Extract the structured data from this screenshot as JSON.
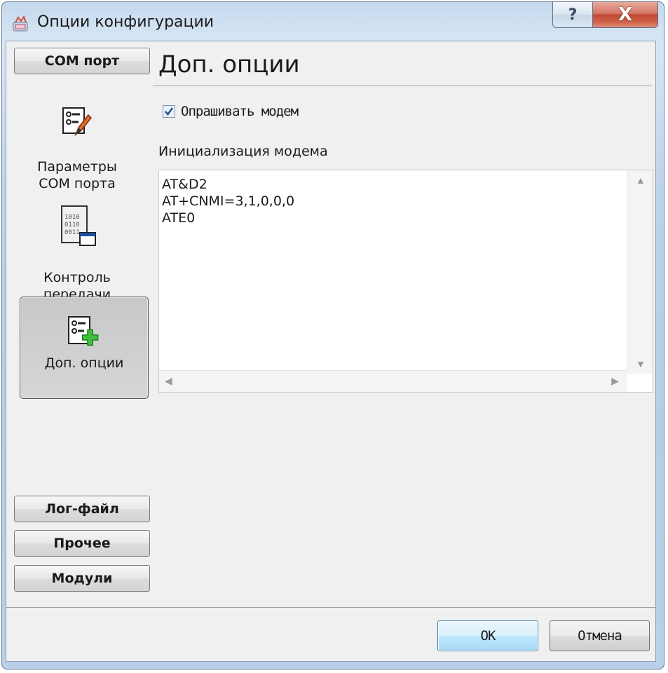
{
  "window": {
    "title": "Опции конфигурации",
    "help_label": "?",
    "close_label": "X"
  },
  "sidebar": {
    "top_button": "COM порт",
    "items": [
      {
        "label": "Параметры\nCOM порта",
        "icon": "settings-edit-icon"
      },
      {
        "label": "Контроль\nпередачи\nданных",
        "icon": "data-transfer-icon"
      },
      {
        "label": "Доп. опции",
        "icon": "settings-add-icon",
        "active": true
      }
    ],
    "bottom_buttons": [
      "Лог-файл",
      "Прочее",
      "Модули"
    ]
  },
  "main": {
    "heading": "Доп. опции",
    "poll_modem": {
      "label": "Опрашивать модем",
      "checked": true
    },
    "init_label": "Инициализация модема",
    "init_text": "AT&D2\nAT+CNMI=3,1,0,0,0\nATE0"
  },
  "footer": {
    "ok_label": "OK",
    "cancel_label": "Отмена"
  },
  "colors": {
    "frame": "#b9d0e9",
    "client": "#f0f0f0",
    "ok_border": "#3c7fb1",
    "close_red": "#c14a33"
  }
}
